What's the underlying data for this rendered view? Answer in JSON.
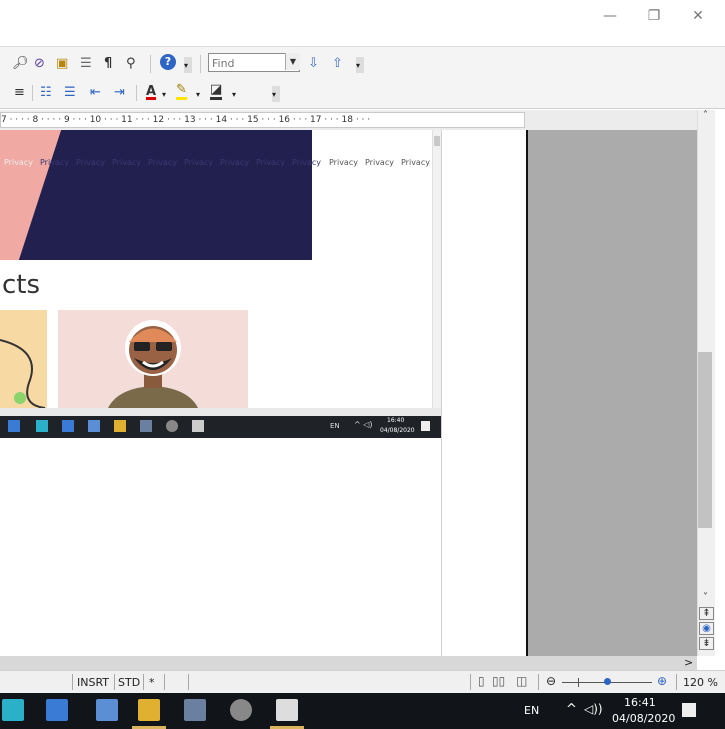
{
  "window": {
    "minimize_label": "—",
    "restore_label": "❐",
    "close_label": "✕"
  },
  "toolbar1": {
    "find_placeholder": "Find"
  },
  "ruler": {
    "text": "7 · ·  · · 8 · · · · 9 · · · 10 · · · 11 · · · 12 · · · 13 · · · 14 · · · 15 · · · 16 · · · 17 · · · 18 · · ·"
  },
  "embedded_page": {
    "privacy_links": [
      "Privacy",
      "Privacy",
      "Privacy",
      "Privacy",
      "Privacy",
      "Privacy",
      "Privacy",
      "Privacy",
      "Privacy",
      "Privacy",
      "Privacy",
      "Privacy"
    ],
    "heading_fragment": "cts",
    "taskbar": {
      "lang": "EN",
      "time": "16:40",
      "date": "04/08/2020"
    }
  },
  "statusbar": {
    "insert_mode": "INSRT",
    "selection_mode": "STD",
    "modified": "*",
    "zoom": "120 %"
  },
  "taskbar": {
    "lang": "EN",
    "time": "16:41",
    "date": "04/08/2020"
  }
}
